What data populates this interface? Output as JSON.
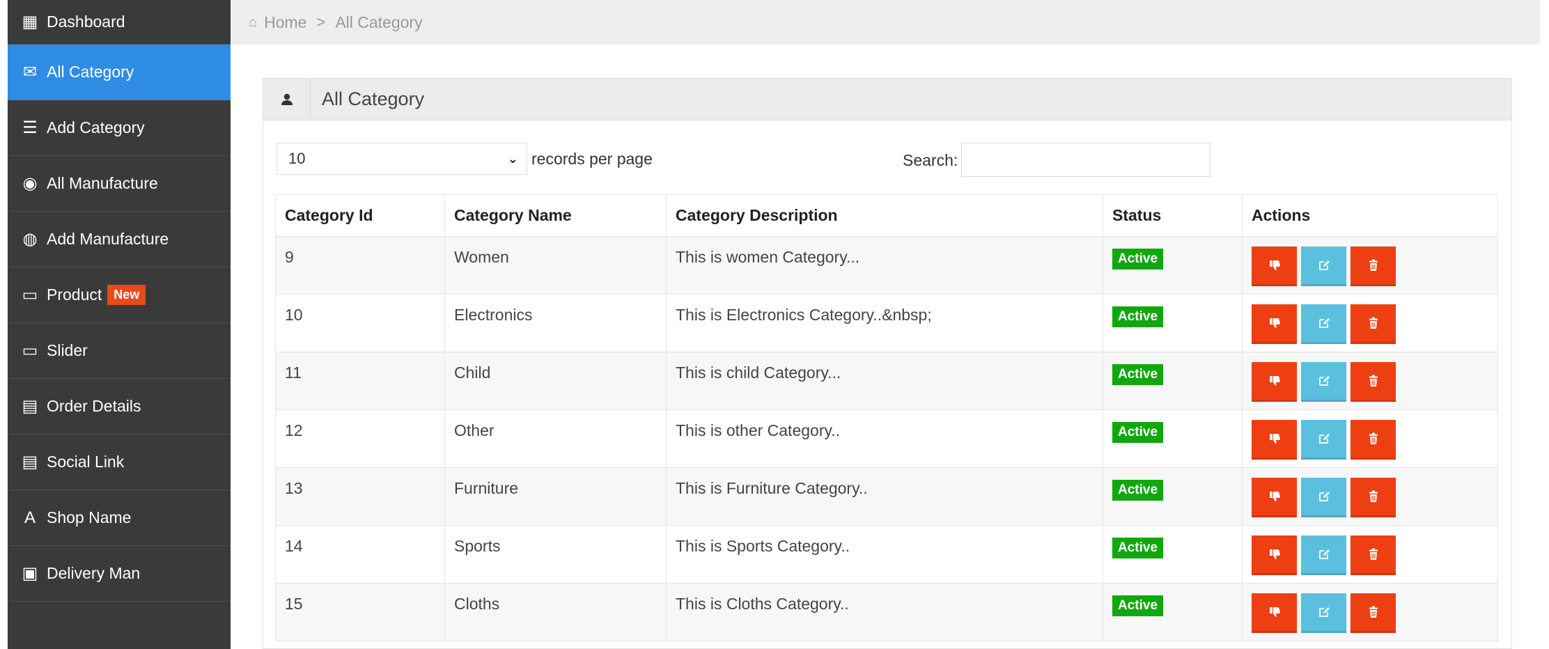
{
  "sidebar": {
    "items": [
      {
        "label": "Dashboard",
        "icon": "bar-chart-icon",
        "glyph": "▦",
        "active": false
      },
      {
        "label": "All Category",
        "icon": "envelope-icon",
        "glyph": "✉",
        "active": true
      },
      {
        "label": "Add Category",
        "icon": "server-icon",
        "glyph": "☰",
        "active": false
      },
      {
        "label": "All Manufacture",
        "icon": "eye-icon",
        "glyph": "◉",
        "active": false
      },
      {
        "label": "Add Manufacture",
        "icon": "dashboard-gauge-icon",
        "glyph": "◍",
        "active": false
      },
      {
        "label": "Product",
        "icon": "folder-icon",
        "glyph": "▭",
        "active": false,
        "badge": "New"
      },
      {
        "label": "Slider",
        "icon": "folder-icon",
        "glyph": "▭",
        "active": false
      },
      {
        "label": "Order Details",
        "icon": "list-alt-icon",
        "glyph": "▤",
        "active": false
      },
      {
        "label": "Social Link",
        "icon": "list-alt-icon",
        "glyph": "▤",
        "active": false
      },
      {
        "label": "Shop Name",
        "icon": "font-icon",
        "glyph": "A",
        "active": false
      },
      {
        "label": "Delivery Man",
        "icon": "picture-icon",
        "glyph": "▣",
        "active": false
      }
    ]
  },
  "breadcrumb": {
    "home": "Home",
    "separator": ">",
    "current": "All Category"
  },
  "panel": {
    "title": "All Category",
    "icon": "user-icon"
  },
  "controls": {
    "per_page_value": "10",
    "per_page_label": "records per page",
    "search_label": "Search:",
    "search_value": ""
  },
  "table": {
    "headers": [
      "Category Id",
      "Category Name",
      "Category Description",
      "Status",
      "Actions"
    ],
    "rows": [
      {
        "id": "9",
        "name": "Women",
        "description": "This is women Category...",
        "status": "Active"
      },
      {
        "id": "10",
        "name": "Electronics",
        "description": "This is Electronics Category..&nbsp;",
        "status": "Active"
      },
      {
        "id": "11",
        "name": "Child",
        "description": "This is child Category...",
        "status": "Active"
      },
      {
        "id": "12",
        "name": "Other",
        "description": "This is other Category..",
        "status": "Active"
      },
      {
        "id": "13",
        "name": "Furniture",
        "description": "This is Furniture Category..",
        "status": "Active"
      },
      {
        "id": "14",
        "name": "Sports",
        "description": "This is Sports Category..",
        "status": "Active"
      },
      {
        "id": "15",
        "name": "Cloths",
        "description": "This is Cloths Category..",
        "status": "Active"
      }
    ],
    "action_icons": [
      "thumbs-down-icon",
      "edit-icon",
      "trash-icon"
    ]
  },
  "colors": {
    "sidebar_bg": "#3a3a3a",
    "sidebar_active": "#2f8ce5",
    "badge_new": "#e94a1b",
    "status_active": "#11a80f",
    "btn_red": "#ed3f12",
    "btn_blue": "#5bc0de"
  }
}
